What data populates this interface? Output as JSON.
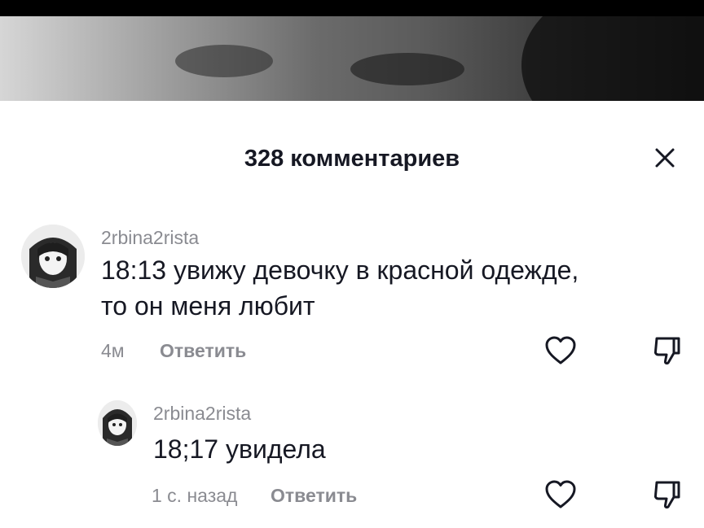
{
  "header": {
    "title": "328 комментариев",
    "close_icon": "close-icon"
  },
  "comments": [
    {
      "username": "2rbina2rista",
      "text_line1": "18:13 увижу девочку в красной одежде,",
      "text_line2": "то он меня любит",
      "time": "4м",
      "reply_label": "Ответить",
      "like_icon": "heart-outline-icon",
      "dislike_icon": "thumbs-down-icon"
    },
    {
      "username": "2rbina2rista",
      "text": "18;17 увидела",
      "time": "1 с. назад",
      "reply_label": "Ответить",
      "like_icon": "heart-outline-icon",
      "dislike_icon": "thumbs-down-icon"
    }
  ],
  "colors": {
    "text_primary": "#161823",
    "text_secondary": "#8a8b91",
    "background": "#ffffff"
  }
}
